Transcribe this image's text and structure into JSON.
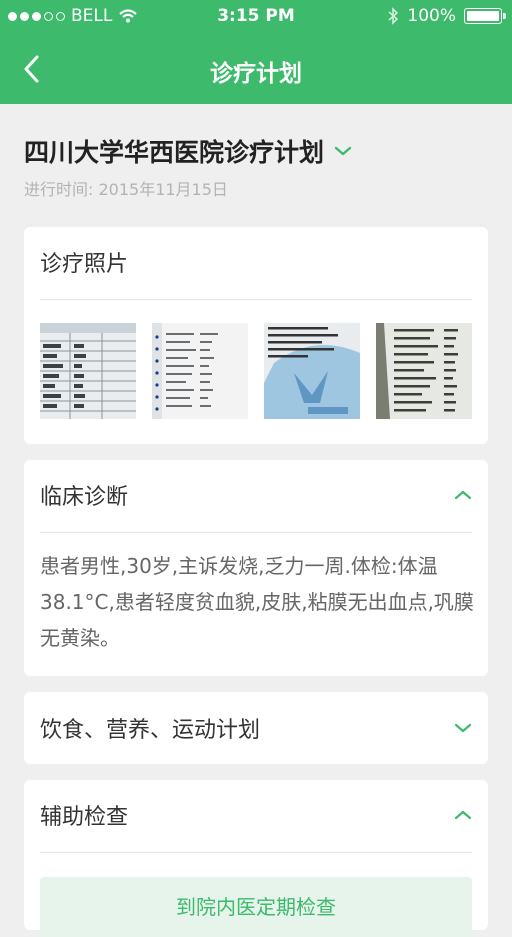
{
  "status_bar": {
    "carrier": "BELL",
    "time": "3:15 PM",
    "battery": "100%"
  },
  "nav": {
    "title": "诊疗计划"
  },
  "plan": {
    "title": "四川大学华西医院诊疗计划",
    "date": "进行时间: 2015年11月15日"
  },
  "photos_section": {
    "title": "诊疗照片"
  },
  "diagnosis": {
    "title": "临床诊断",
    "text": "患者男性,30岁,主诉发烧,乏力一周.体检:体温38.1°C,患者轻度贫血貌,皮肤,粘膜无出血点,巩膜无黄染。"
  },
  "diet": {
    "title": "饮食、营养、运动计划"
  },
  "exam": {
    "title": "辅助检查",
    "button_label": "到院内医定期检查"
  },
  "colors": {
    "brand_green": "#3dba6b"
  }
}
